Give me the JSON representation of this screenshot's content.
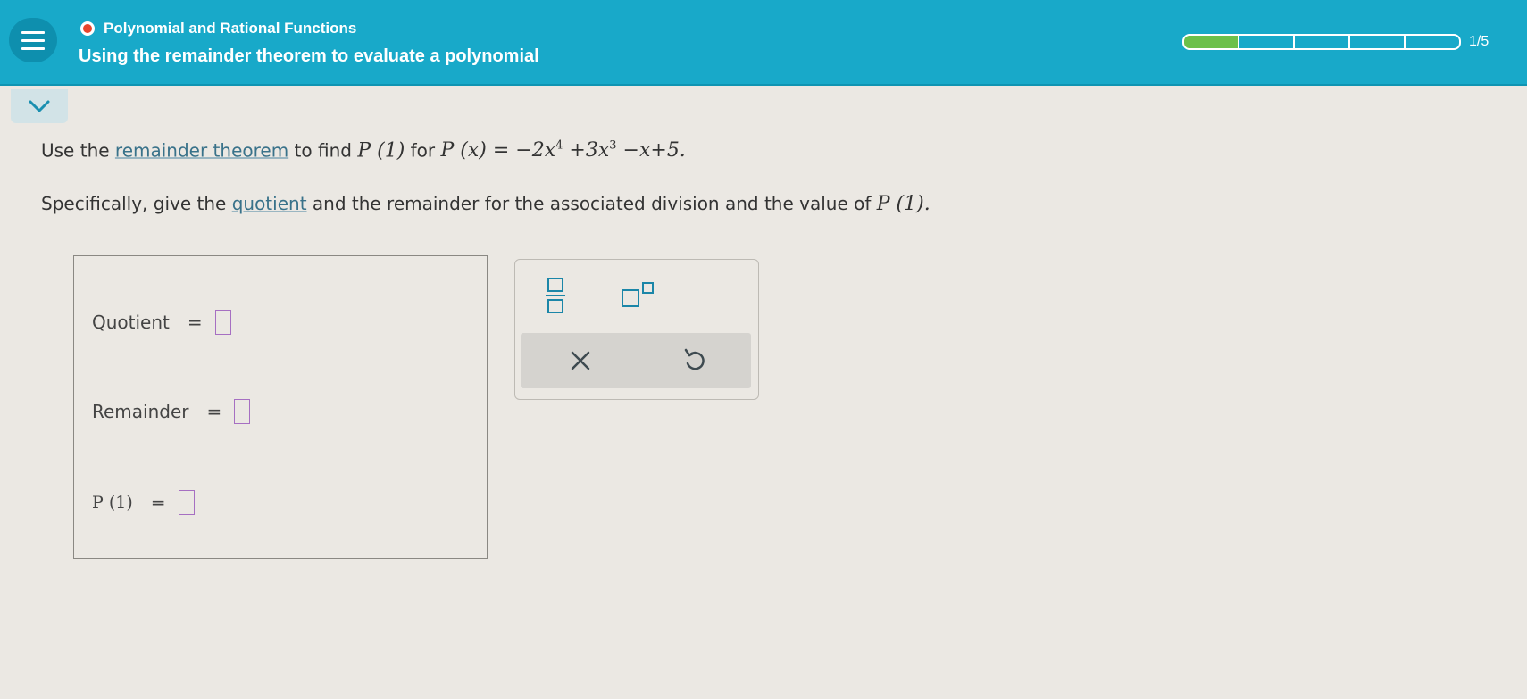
{
  "header": {
    "topic": "Polynomial and Rational Functions",
    "lesson_title": "Using the remainder theorem to evaluate a polynomial",
    "progress_text": "1/5",
    "progress": {
      "filled": 1,
      "total": 5
    },
    "accent_color": "#18a9c9",
    "progress_color": "#6cc04a",
    "topic_dot_color": "#e8452c"
  },
  "collapse": {
    "icon": "chevron-down-icon"
  },
  "prompt": {
    "line1_pre": "Use the ",
    "line1_link": "remainder theorem",
    "line1_mid": " to find ",
    "line1_eval": "P (1)",
    "line1_for": " for ",
    "poly_lhs": "P (x) = −2x",
    "exp4": "4",
    "poly_mid": " +3x",
    "exp3": "3",
    "poly_end": " −x+5.",
    "line2_pre": "Specifically, give the ",
    "line2_link": "quotient",
    "line2_post": " and the remainder for the associated division and the value of ",
    "line2_eval": "P (1)."
  },
  "answers": {
    "quotient_label": "Quotient",
    "remainder_label": "Remainder",
    "p1_label": "P (1)",
    "equals": "="
  },
  "keypad": {
    "fraction": "fraction-icon",
    "exponent": "exponent-icon",
    "clear": "clear-x-icon",
    "undo": "undo-icon"
  }
}
